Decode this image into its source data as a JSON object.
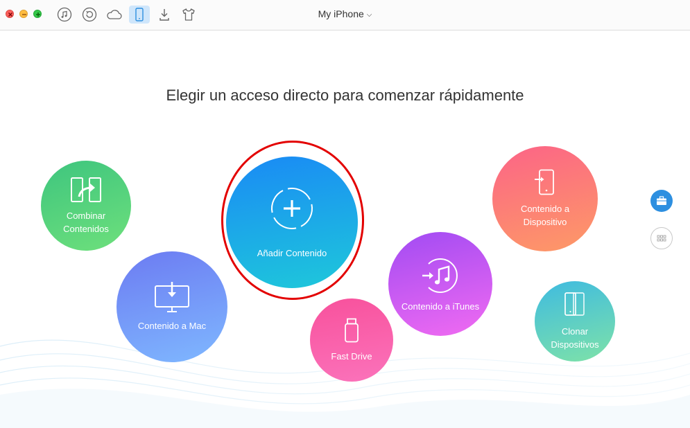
{
  "window": {
    "title": "My iPhone",
    "title_chevron": "⌄"
  },
  "toolbar": {
    "icons": [
      "music-icon",
      "restore-icon",
      "cloud-icon",
      "phone-icon",
      "download-icon",
      "tshirt-icon"
    ],
    "active_icon": "phone-icon"
  },
  "main": {
    "headline": "Elegir un acceso directo para comenzar rápidamente"
  },
  "shortcuts": {
    "combinar": {
      "label": "Combinar Contenidos",
      "icon": "merge-icon"
    },
    "mac": {
      "label": "Contenido a Mac",
      "icon": "monitor-download-icon"
    },
    "anadir": {
      "label": "Añadir Contenido",
      "icon": "plus-circle-icon"
    },
    "fastdrive": {
      "label": "Fast Drive",
      "icon": "usb-drive-icon"
    },
    "itunes": {
      "label": "Contenido a iTunes",
      "icon": "itunes-icon"
    },
    "dispositivo": {
      "label": "Contenido a Dispositivo",
      "icon": "phone-import-icon"
    },
    "clonar": {
      "label": "Clonar Dispositivos",
      "icon": "clone-devices-icon"
    }
  },
  "colors": {
    "close": "#fc605c",
    "minimize": "#fdbc40",
    "zoom": "#34c84a",
    "highlight": "#e30000",
    "accent": "#2d8fe0"
  }
}
